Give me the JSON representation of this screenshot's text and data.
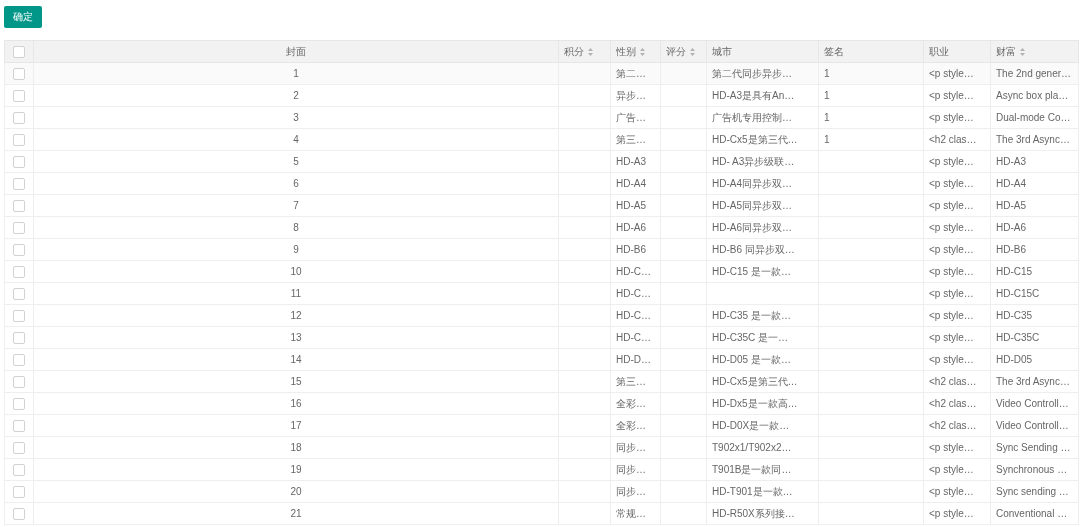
{
  "confirm_button": "确定",
  "table": {
    "select_all": {
      "checked": false
    },
    "columns": [
      {
        "label": "封面",
        "sortable": false
      },
      {
        "label": "积分",
        "sortable": true
      },
      {
        "label": "性别",
        "sortable": true
      },
      {
        "label": "评分",
        "sortable": true
      },
      {
        "label": "城市",
        "sortable": false
      },
      {
        "label": "签名",
        "sortable": false
      },
      {
        "label": "职业",
        "sortable": false
      },
      {
        "label": "财富",
        "sortable": true
      }
    ],
    "rows": [
      {
        "checked": false,
        "cells": [
          "1",
          null,
          "第二…",
          null,
          "第二代同步异步…",
          "1",
          "<p style…",
          "The 2nd gener…"
        ]
      },
      {
        "checked": false,
        "cells": [
          "2",
          null,
          "异步…",
          null,
          "HD-A3是具有An…",
          "1",
          "<p style…",
          "Async box pla…"
        ]
      },
      {
        "checked": false,
        "cells": [
          "3",
          null,
          "广告…",
          null,
          "广告机专用控制…",
          "1",
          "<p style…",
          "Dual-mode Co…"
        ]
      },
      {
        "checked": false,
        "cells": [
          "4",
          null,
          "第三…",
          null,
          "HD-Cx5是第三代…",
          "1",
          "<h2 clas…",
          "The 3rd Async…"
        ]
      },
      {
        "checked": false,
        "cells": [
          "5",
          null,
          "HD-A3",
          null,
          "HD- A3异步级联…",
          null,
          "<p style…",
          "HD-A3"
        ]
      },
      {
        "checked": false,
        "cells": [
          "6",
          null,
          "HD-A4",
          null,
          "HD-A4同异步双…",
          null,
          "<p style…",
          "HD-A4"
        ]
      },
      {
        "checked": false,
        "cells": [
          "7",
          null,
          "HD-A5",
          null,
          "HD-A5同异步双…",
          null,
          "<p style…",
          "HD-A5"
        ]
      },
      {
        "checked": false,
        "cells": [
          "8",
          null,
          "HD-A6",
          null,
          "HD-A6同异步双…",
          null,
          "<p style…",
          "HD-A6"
        ]
      },
      {
        "checked": false,
        "cells": [
          "9",
          null,
          "HD-B6",
          null,
          "HD-B6 同异步双…",
          null,
          "<p style…",
          "HD-B6"
        ]
      },
      {
        "checked": false,
        "cells": [
          "10",
          null,
          "HD-C…",
          null,
          "HD-C15 是一款…",
          null,
          "<p style…",
          "HD-C15"
        ]
      },
      {
        "checked": false,
        "cells": [
          "11",
          null,
          "HD-C…",
          null,
          null,
          null,
          "<p style…",
          "HD-C15C"
        ]
      },
      {
        "checked": false,
        "cells": [
          "12",
          null,
          "HD-C…",
          null,
          "HD-C35 是一款…",
          null,
          "<p style…",
          "HD-C35"
        ]
      },
      {
        "checked": false,
        "cells": [
          "13",
          null,
          "HD-C…",
          null,
          "HD-C35C 是一…",
          null,
          "<p style…",
          "HD-C35C"
        ]
      },
      {
        "checked": false,
        "cells": [
          "14",
          null,
          "HD-D…",
          null,
          "HD-D05 是一款…",
          null,
          "<p style…",
          "HD-D05"
        ]
      },
      {
        "checked": false,
        "cells": [
          "15",
          null,
          "第三…",
          null,
          "HD-Cx5是第三代…",
          null,
          "<h2 clas…",
          "The 3rd Async…"
        ]
      },
      {
        "checked": false,
        "cells": [
          "16",
          null,
          "全彩…",
          null,
          "HD-Dx5是一款高…",
          null,
          "<h2 clas…",
          "Video Controll…"
        ]
      },
      {
        "checked": false,
        "cells": [
          "17",
          null,
          "全彩…",
          null,
          "HD-D0X是一款…",
          null,
          "<h2 clas…",
          "Video Controll…"
        ]
      },
      {
        "checked": false,
        "cells": [
          "18",
          null,
          "同步…",
          null,
          "T902x1/T902x2…",
          null,
          "<p style…",
          "Sync Sending …"
        ]
      },
      {
        "checked": false,
        "cells": [
          "19",
          null,
          "同步…",
          null,
          "T901B是一款同…",
          null,
          "<p style…",
          "Synchronous …"
        ]
      },
      {
        "checked": false,
        "cells": [
          "20",
          null,
          "同步…",
          null,
          "HD-T901是一款…",
          null,
          "<p style…",
          "Sync sending …"
        ]
      },
      {
        "checked": false,
        "cells": [
          "21",
          null,
          "常规…",
          null,
          "HD-R50X系列接…",
          null,
          "<p style…",
          "Conventional …"
        ]
      }
    ]
  }
}
